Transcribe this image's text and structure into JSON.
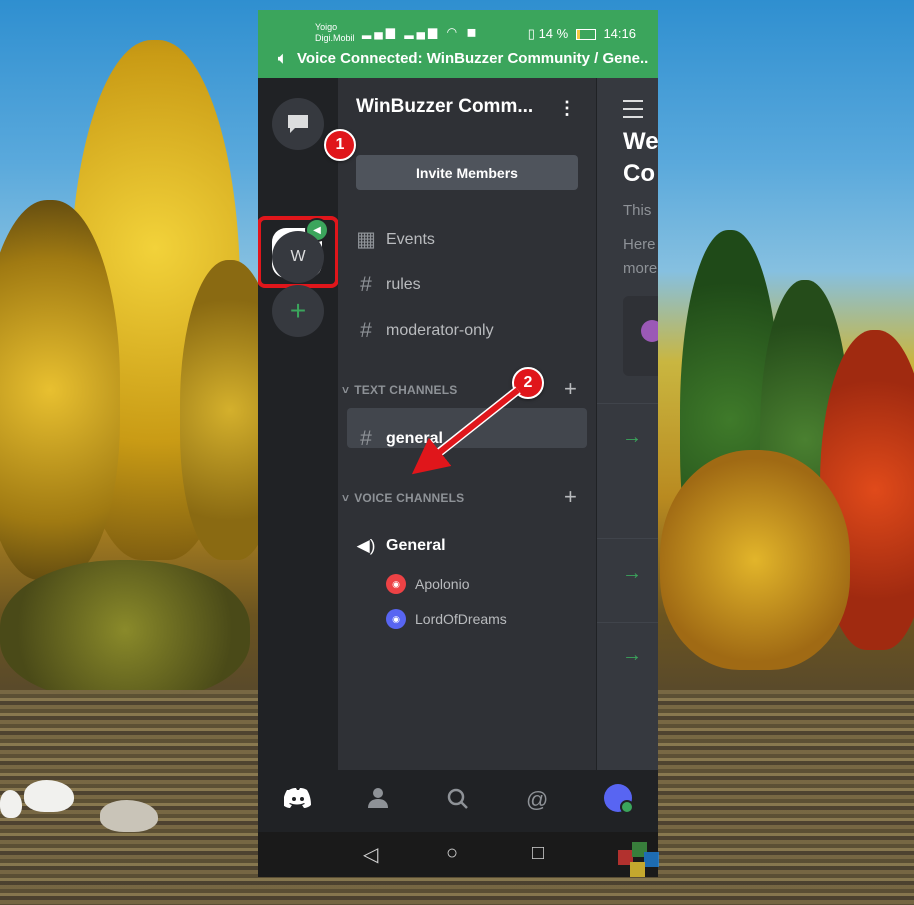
{
  "status_bar": {
    "carrier_line1": "Yoigo",
    "carrier_line2": "Digi.Mobil",
    "battery": "14 %",
    "time": "14:16",
    "voice_banner": "Voice Connected: WinBuzzer Community / Gene..."
  },
  "guilds": {
    "letter_server": "W"
  },
  "channels_panel": {
    "server_title": "WinBuzzer Comm...",
    "invite_label": "Invite Members",
    "top_items": [
      {
        "label": "Events"
      },
      {
        "label": "rules"
      },
      {
        "label": "moderator-only"
      }
    ],
    "text_category": "TEXT CHANNELS",
    "text_channels": [
      {
        "label": "general"
      }
    ],
    "voice_category": "VOICE CHANNELS",
    "voice_channel": "General",
    "voice_members": [
      {
        "name": "Apolonio",
        "color": "#ed4245"
      },
      {
        "name": "LordOfDreams",
        "color": "#5865f2"
      }
    ]
  },
  "peek_panel": {
    "line1": "We",
    "line2": "Co",
    "line3": "This",
    "line4": "Here",
    "line5": "more"
  },
  "annotations": {
    "step1": "1",
    "step2": "2"
  },
  "icons": {
    "dm": "chat-bubble-icon",
    "add_server": "plus-icon",
    "events": "calendar-icon",
    "channel": "hash-icon",
    "voice": "speaker-icon",
    "menu": "hamburger-icon",
    "nav": [
      "discord-home-icon",
      "friends-icon",
      "search-icon",
      "mention-icon",
      "profile-avatar-icon"
    ],
    "android": [
      "back-icon",
      "home-icon",
      "recents-icon"
    ]
  },
  "colors": {
    "status_green": "#3ba55c",
    "annotation_red": "#e0161b",
    "discord_bg": "#2f3136"
  }
}
